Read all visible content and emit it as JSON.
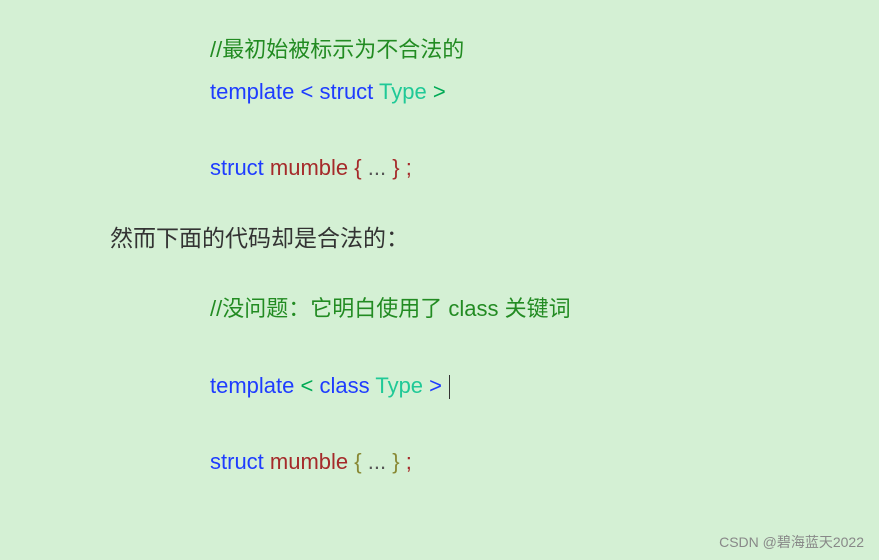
{
  "block1": {
    "comment": "//最初始被标示为不合法的",
    "line2": {
      "kw1": "template",
      "op1": "<",
      "kw2": "struct",
      "type": "Type",
      "op2": ">"
    },
    "line3": {
      "kw": "struct",
      "name": "mumble",
      "brace_open": "{",
      "dots": "...",
      "brace_close": "}",
      "semi": ";"
    }
  },
  "prose1": "然而下面的代码却是合法的：",
  "block2": {
    "comment": "//没问题：它明白使用了 class 关键词",
    "line2": {
      "kw1": "template",
      "op1": "<",
      "kw2": "class",
      "type": "Type",
      "op2": ">"
    },
    "line3": {
      "kw": "struct",
      "name": "mumble",
      "brace_open": "{",
      "dots": "...",
      "brace_close": "}",
      "semi": ";"
    }
  },
  "watermark": "CSDN @碧海蓝天2022"
}
